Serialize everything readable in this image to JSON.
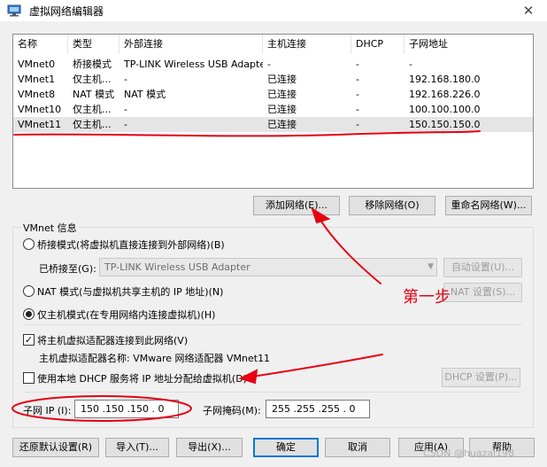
{
  "window": {
    "title": "虚拟网络编辑器",
    "close_glyph": "✕"
  },
  "table": {
    "headers": [
      "名称",
      "类型",
      "外部连接",
      "主机连接",
      "DHCP",
      "子网地址"
    ],
    "rows": [
      [
        "VMnet0",
        "桥接模式",
        "TP-LINK Wireless USB Adapter",
        "-",
        "-",
        "-"
      ],
      [
        "VMnet1",
        "仅主机...",
        "-",
        "已连接",
        "-",
        "192.168.180.0"
      ],
      [
        "VMnet8",
        "NAT 模式",
        "NAT 模式",
        "已连接",
        "-",
        "192.168.226.0"
      ],
      [
        "VMnet10",
        "仅主机...",
        "-",
        "已连接",
        "-",
        "100.100.100.0"
      ],
      [
        "VMnet11",
        "仅主机...",
        "-",
        "已连接",
        "-",
        "150.150.150.0"
      ]
    ],
    "selected_row": 4
  },
  "list_buttons": {
    "add": "添加网络(E)...",
    "remove": "移除网络(O)",
    "rename": "重命名网络(W)..."
  },
  "vmnet_info": {
    "group_label": "VMnet 信息",
    "bridged_label": "桥接模式(将虚拟机直接连接到外部网络)(B)",
    "bridged_to_label": "已桥接至(G):",
    "bridged_to_value": "TP-LINK Wireless USB Adapter",
    "auto_settings": "自动设置(U)...",
    "nat_label": "NAT 模式(与虚拟机共享主机的 IP 地址)(N)",
    "nat_settings": "NAT 设置(S)...",
    "hostonly_label": "仅主机模式(在专用网络内连接虚拟机)(H)",
    "mode_selected": "hostonly",
    "connect_adapter_label": "将主机虚拟适配器连接到此网络(V)",
    "connect_adapter_checked": true,
    "adapter_name_label": "主机虚拟适配器名称: VMware 网络适配器 VMnet11",
    "dhcp_label": "使用本地 DHCP 服务将 IP 地址分配给虚拟机(D)",
    "dhcp_checked": false,
    "dhcp_settings": "DHCP 设置(P)...",
    "subnet_ip_label": "子网 IP (I):",
    "subnet_ip_value": "150 .150 .150 . 0",
    "subnet_mask_label": "子网掩码(M):",
    "subnet_mask_value": "255 .255 .255 . 0"
  },
  "footer_buttons": {
    "restore": "还原默认设置(R)",
    "import": "导入(T)...",
    "export": "导出(X)...",
    "ok": "确定",
    "cancel": "取消",
    "apply": "应用(A)",
    "help": "帮助"
  },
  "annotation": {
    "step_text": "第一步",
    "color": "#e60012"
  },
  "watermark": "CSDN @huazai198"
}
